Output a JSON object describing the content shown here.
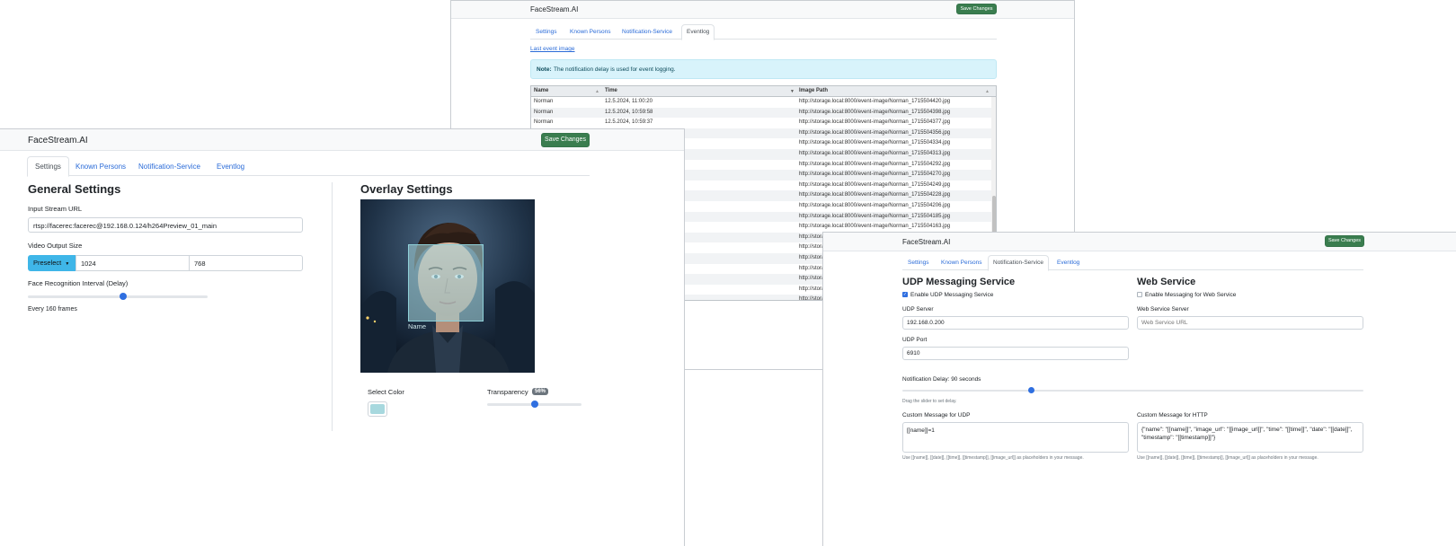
{
  "eventlog_window": {
    "brand": "FaceStream.AI",
    "save_label": "Save Changes",
    "tabs": [
      "Settings",
      "Known Persons",
      "Notification-Service",
      "Eventlog"
    ],
    "last_event_link": "Last event image",
    "note_label": "Note:",
    "note_text": "The notification delay is used for event logging.",
    "columns": [
      "Name",
      "Time",
      "Image Path"
    ],
    "rows": [
      {
        "name": "Norman",
        "time": "12.5.2024, 11:00:20",
        "path": "http://storage.local:8000/event-image/Norman_1715504420.jpg"
      },
      {
        "name": "Norman",
        "time": "12.5.2024, 10:59:58",
        "path": "http://storage.local:8000/event-image/Norman_1715504398.jpg"
      },
      {
        "name": "Norman",
        "time": "12.5.2024, 10:59:37",
        "path": "http://storage.local:8000/event-image/Norman_1715504377.jpg"
      },
      {
        "name": "",
        "time": "",
        "path": "http://storage.local:8000/event-image/Norman_1715504356.jpg"
      },
      {
        "name": "",
        "time": "",
        "path": "http://storage.local:8000/event-image/Norman_1715504334.jpg"
      },
      {
        "name": "",
        "time": "",
        "path": "http://storage.local:8000/event-image/Norman_1715504313.jpg"
      },
      {
        "name": "",
        "time": "",
        "path": "http://storage.local:8000/event-image/Norman_1715504292.jpg"
      },
      {
        "name": "",
        "time": "",
        "path": "http://storage.local:8000/event-image/Norman_1715504270.jpg"
      },
      {
        "name": "",
        "time": "",
        "path": "http://storage.local:8000/event-image/Norman_1715504249.jpg"
      },
      {
        "name": "",
        "time": "",
        "path": "http://storage.local:8000/event-image/Norman_1715504228.jpg"
      },
      {
        "name": "",
        "time": "",
        "path": "http://storage.local:8000/event-image/Norman_1715504206.jpg"
      },
      {
        "name": "",
        "time": "",
        "path": "http://storage.local:8000/event-image/Norman_1715504185.jpg"
      },
      {
        "name": "",
        "time": "",
        "path": "http://storage.local:8000/event-image/Norman_1715504163.jpg"
      },
      {
        "name": "",
        "time": "",
        "path": "http://stora"
      },
      {
        "name": "",
        "time": "",
        "path": "http://stora"
      },
      {
        "name": "",
        "time": "",
        "path": "http://stora"
      },
      {
        "name": "",
        "time": "",
        "path": "http://stora"
      },
      {
        "name": "",
        "time": "",
        "path": "http://stora"
      },
      {
        "name": "",
        "time": "",
        "path": "http://stora"
      },
      {
        "name": "",
        "time": "",
        "path": "http://stora"
      }
    ]
  },
  "settings_window": {
    "brand": "FaceStream.AI",
    "save_label": "Save Changes",
    "tabs": [
      "Settings",
      "Known Persons",
      "Notification-Service",
      "Eventlog"
    ],
    "general_title": "General Settings",
    "input_stream_label": "Input Stream URL",
    "input_stream_value": "rtsp://facerec:facerec@192.168.0.124/h264Preview_01_main",
    "video_output_label": "Video Output Size",
    "preselect_label": "Preselect",
    "width_value": "1024",
    "height_value": "768",
    "interval_label": "Face Recognition Interval (Delay)",
    "interval_level": 0.53,
    "interval_text": "Every 160 frames",
    "overlay_title": "Overlay Settings",
    "overlay_name_label": "Name",
    "select_color_label": "Select Color",
    "selected_color": "#a7d8de",
    "transparency_label": "Transparency",
    "transparency_badge": "56%",
    "transparency_level": 0.5
  },
  "notification_window": {
    "brand": "FaceStream.AI",
    "save_label": "Save Changes",
    "tabs": [
      "Settings",
      "Known Persons",
      "Notification-Service",
      "Eventlog"
    ],
    "udp_title": "UDP Messaging Service",
    "udp_enable_label": "Enable UDP Messaging Service",
    "udp_server_label": "UDP Server",
    "udp_server_value": "192.168.0.200",
    "udp_port_label": "UDP Port",
    "udp_port_value": "6910",
    "web_title": "Web Service",
    "web_enable_label": "Enable Messaging for Web Service",
    "web_server_label": "Web Service Server",
    "web_server_placeholder": "Web Service URL",
    "delay_label": "Notification Delay: 90 seconds",
    "delay_level": 0.28,
    "delay_hint": "Drag the slider to set delay.",
    "udp_msg_label": "Custom Message for UDP",
    "udp_msg_value": "[[name]]=1",
    "http_msg_label": "Custom Message for HTTP",
    "http_msg_value": "{\"name\": \"[[name]]\", \"image_url\": \"[[image_url]]\", \"time\": \"[[time]]\", \"date\": \"[[date]]\", \"timestamp\": \"[[timestamp]]\"}",
    "placeholder_help": "Use [[name]], [[date]], [[time]], [[timestamp]], [[image_url]] as placeholders in your message."
  },
  "colors": {
    "accent": "#2f6fe0",
    "save_green": "#3a7d4f",
    "preselect_blue": "#3fb6e8",
    "note_bg": "#d8f3fb",
    "badge_grey": "#6c757d"
  }
}
